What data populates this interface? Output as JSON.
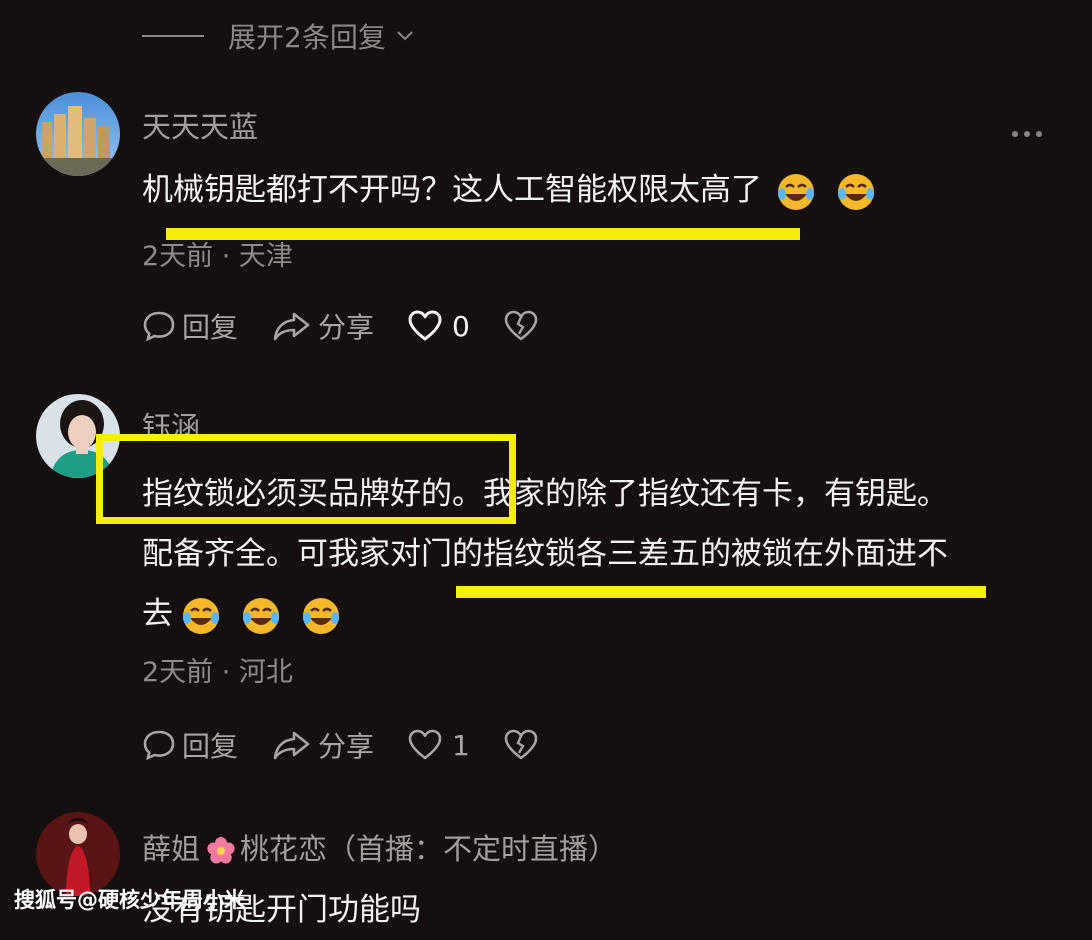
{
  "expand_replies": {
    "label": "展开2条回复"
  },
  "comments": [
    {
      "username": "天天天蓝",
      "text_lines": [
        "机械钥匙都打不开吗？这人工智能权限太高了"
      ],
      "emoji_count": 2,
      "meta": "2天前 · 天津",
      "actions": {
        "reply": "回复",
        "share": "分享",
        "likes": "0"
      }
    },
    {
      "username": "钰涵",
      "text_lines": [
        "指纹锁必须买品牌好的。我家的除了指纹还有卡，有钥匙。",
        "配备齐全。可我家对门的指纹锁各三差五的被锁在外面进不",
        "去"
      ],
      "emoji_count": 3,
      "meta": "2天前 · 河北",
      "actions": {
        "reply": "回复",
        "share": "分享",
        "likes": "1"
      }
    },
    {
      "username_part1": "薛姐",
      "username_part2": "桃花恋（首播：不定时直播）",
      "text_lines": [
        "没有钥匙开门功能吗"
      ]
    }
  ],
  "watermark": "搜狐号@硬核少年周小米",
  "colors": {
    "highlight": "#f4ee08",
    "background": "#150f0f"
  }
}
